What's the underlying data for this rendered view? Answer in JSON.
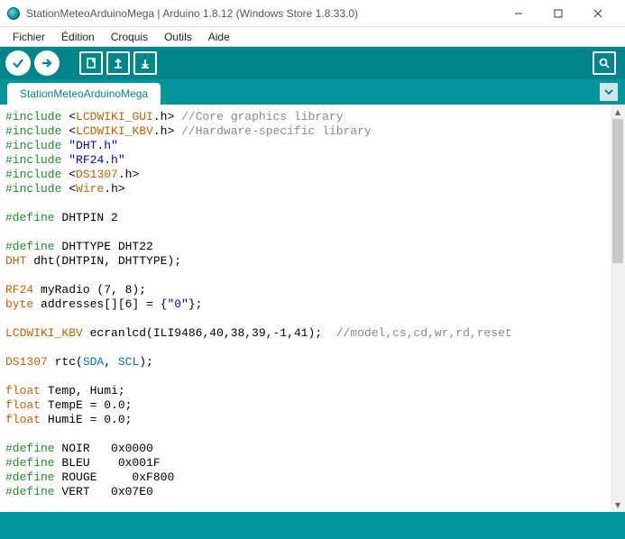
{
  "titlebar": {
    "title": "StationMeteoArduinoMega | Arduino 1.8.12 (Windows Store 1.8.33.0)"
  },
  "menu": {
    "file": "Fichier",
    "edit": "Édition",
    "sketch": "Croquis",
    "tools": "Outils",
    "help": "Aide"
  },
  "tab": {
    "name": "StationMeteoArduinoMega"
  },
  "code": {
    "include": "#include",
    "define": "#define",
    "lcdgui_open": "<",
    "lcdgui": "LCDWIKI_GUI",
    "lcdgui_ext": ".h>",
    "lcdgui_comment": "//Core graphics library",
    "lcdkbv": "LCDWIKI_KBV",
    "lcdkbv_ext": ".h>",
    "lcdkbv_comment": "//Hardware-specific library",
    "dht_h": "\"DHT.h\"",
    "rf24_h": "\"RF24.h\"",
    "ds1307": "DS1307",
    "ds1307_ext": ".h>",
    "wire": "Wire",
    "wire_ext": ".h>",
    "dhtpin": "DHTPIN 2",
    "dhttype": "DHTTYPE DHT22",
    "dht_type": "DHT",
    "dht_inst": " dht(DHTPIN, DHTTYPE);",
    "rf24": "RF24",
    "rf24_inst": " myRadio (7, 8);",
    "byte": "byte",
    "addresses": " addresses[][6] = {",
    "zero": "\"0\"",
    "addr_end": "};",
    "lcdkbv_inst": " ecranlcd(ILI9486,40,38,39,-1,41);",
    "lcdkbv_cmt": "//model,cs,cd,wr,rd,reset",
    "rtc": " rtc(",
    "sda": "SDA",
    "comma": ", ",
    "scl": "SCL",
    "rtc_end": ");",
    "float": "float",
    "temphumi": " Temp, Humi;",
    "tempe": " TempE = 0.0;",
    "humie": " HumiE = 0.0;",
    "noir": "NOIR   0x0000",
    "bleu": "BLEU    0x001F",
    "rouge": "ROUGE     0xF800",
    "vert": "VERT   0x07E0"
  }
}
